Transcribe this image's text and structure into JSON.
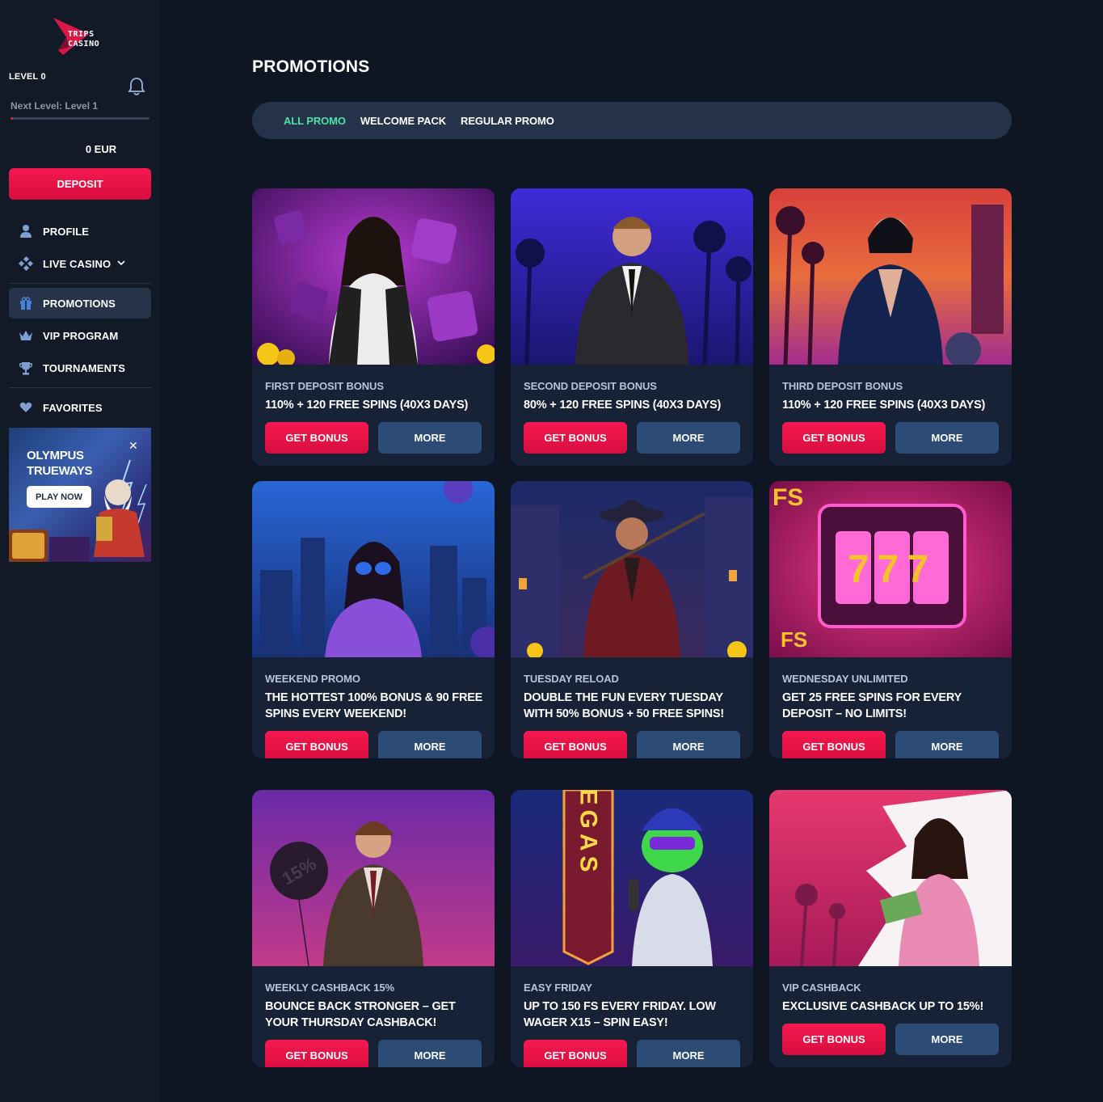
{
  "brand": {
    "line1": "TRIPS",
    "line2": "CASINO"
  },
  "user": {
    "level": "LEVEL 0",
    "next_level": "Next Level: Level 1",
    "progress": 0.02,
    "balance": "0 EUR"
  },
  "sidebar": {
    "deposit_label": "DEPOSIT",
    "items": [
      {
        "label": "PROFILE",
        "icon": "user-icon"
      },
      {
        "label": "LIVE CASINO",
        "icon": "chips-icon"
      },
      {
        "label": "PROMOTIONS",
        "icon": "gift-icon",
        "active": true
      },
      {
        "label": "VIP PROGRAM",
        "icon": "crown-icon"
      },
      {
        "label": "TOURNAMENTS",
        "icon": "trophy-icon"
      },
      {
        "label": "FAVORITES",
        "icon": "heart-icon"
      }
    ],
    "banner": {
      "title_line1": "OLYMPUS",
      "title_line2": "TRUEWAYS",
      "play_label": "PLAY NOW",
      "close": "✕"
    }
  },
  "main": {
    "title": "PROMOTIONS",
    "tabs": [
      {
        "label": "ALL PROMO",
        "active": true
      },
      {
        "label": "WELCOME PACK"
      },
      {
        "label": "REGULAR PROMO"
      }
    ],
    "get_bonus_label": "GET BONUS",
    "more_label": "MORE",
    "promos": [
      {
        "category": "FIRST DEPOSIT BONUS",
        "title": "110% + 120 FREE SPINS (40X3 DAYS)"
      },
      {
        "category": "SECOND DEPOSIT BONUS",
        "title": "80% + 120 FREE SPINS (40X3 DAYS)"
      },
      {
        "category": "THIRD DEPOSIT BONUS",
        "title": "110% + 120 FREE SPINS (40X3 DAYS)"
      },
      {
        "category": "WEEKEND PROMO",
        "title": "THE HOTTEST 100% BONUS & 90 FREE SPINS EVERY WEEKEND!"
      },
      {
        "category": "TUESDAY RELOAD",
        "title": "DOUBLE THE FUN EVERY TUESDAY WITH 50% BONUS + 50 FREE SPINS!"
      },
      {
        "category": "WEDNESDAY UNLIMITED",
        "title": "GET 25 FREE SPINS FOR EVERY DEPOSIT – NO LIMITS!"
      },
      {
        "category": "WEEKLY CASHBACK 15%",
        "title": "BOUNCE BACK STRONGER – GET YOUR THURSDAY CASHBACK!"
      },
      {
        "category": "EASY FRIDAY",
        "title": "UP TO 150 FS EVERY FRIDAY. LOW WAGER X15 – SPIN EASY!"
      },
      {
        "category": "VIP CASHBACK",
        "title": "EXCLUSIVE CASHBACK UP TO 15%!"
      }
    ],
    "art_text": {
      "balloon": "15%",
      "sign": "VEGAS",
      "slot": "777",
      "fs": "FS"
    }
  },
  "colors": {
    "accent": "#e8164a",
    "active_tab": "#4ee0a4",
    "more_button": "#2b4a74",
    "card_bg": "#172236"
  }
}
